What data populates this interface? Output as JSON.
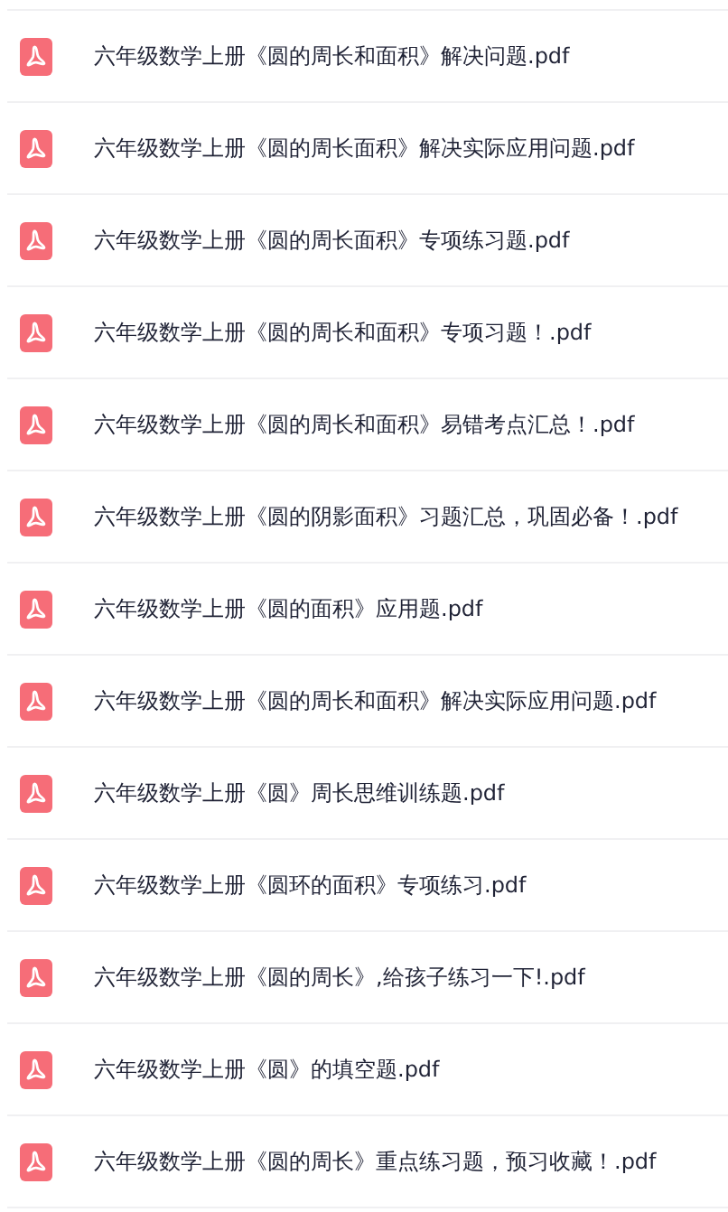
{
  "files": [
    {
      "name": "六年级数学上册《圆的周长和面积》解决问题.pdf"
    },
    {
      "name": "六年级数学上册《圆的周长面积》解决实际应用问题.pdf"
    },
    {
      "name": "六年级数学上册《圆的周长面积》专项练习题.pdf"
    },
    {
      "name": "六年级数学上册《圆的周长和面积》专项习题！.pdf"
    },
    {
      "name": "六年级数学上册《圆的周长和面积》易错考点汇总！.pdf"
    },
    {
      "name": "六年级数学上册《圆的阴影面积》习题汇总，巩固必备！.pdf"
    },
    {
      "name": "六年级数学上册《圆的面积》应用题.pdf"
    },
    {
      "name": "六年级数学上册《圆的周长和面积》解决实际应用问题.pdf"
    },
    {
      "name": "六年级数学上册《圆》周长思维训练题.pdf"
    },
    {
      "name": "六年级数学上册《圆环的面积》专项练习.pdf"
    },
    {
      "name": "六年级数学上册《圆的周长》,给孩子练习一下!.pdf"
    },
    {
      "name": "六年级数学上册《圆》的填空题.pdf"
    },
    {
      "name": "六年级数学上册《圆的周长》重点练习题，预习收藏！.pdf"
    }
  ]
}
